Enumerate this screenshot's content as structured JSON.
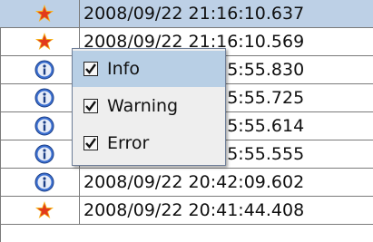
{
  "log": {
    "rows": [
      {
        "level": "error",
        "icon": "star-icon",
        "time": "2008/09/22 21:16:10.637",
        "selected": true
      },
      {
        "level": "error",
        "icon": "star-icon",
        "time": "2008/09/22 21:16:10.569"
      },
      {
        "level": "info",
        "icon": "info-icon",
        "time": "2008/09/22 21:15:55.830"
      },
      {
        "level": "info",
        "icon": "info-icon",
        "time": "2008/09/22 21:15:55.725"
      },
      {
        "level": "info",
        "icon": "info-icon",
        "time": "2008/09/22 21:15:55.614"
      },
      {
        "level": "info",
        "icon": "info-icon",
        "time": "2008/09/22 21:15:55.555"
      },
      {
        "level": "info",
        "icon": "info-icon",
        "time": "2008/09/22 20:42:09.602"
      },
      {
        "level": "error",
        "icon": "star-icon",
        "time": "2008/09/22 20:41:44.408"
      }
    ]
  },
  "filter_menu": {
    "items": [
      {
        "label": "Info",
        "checked": true,
        "hover": true
      },
      {
        "label": "Warning",
        "checked": true
      },
      {
        "label": "Error",
        "checked": true
      }
    ]
  },
  "colors": {
    "selection": "#bdd0e6",
    "star": "#e23a1c",
    "star_glow": "#f6b21b",
    "info": "#3b6fd0"
  }
}
